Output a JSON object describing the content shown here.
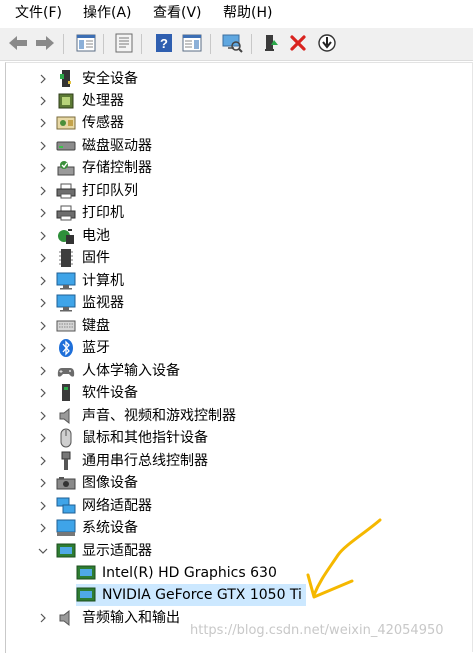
{
  "menu": {
    "file": "文件(F)",
    "action": "操作(A)",
    "view": "查看(V)",
    "help": "帮助(H)"
  },
  "toolbar": {
    "buttons": [
      "back-icon",
      "forward-icon",
      "show-hide-tree-icon",
      "properties-icon",
      "help-icon",
      "action-pane-icon",
      "scan-hardware-icon",
      "enable-device-icon",
      "uninstall-device-icon",
      "update-driver-icon"
    ]
  },
  "tree": {
    "categories": [
      {
        "label": "安全设备",
        "icon": "security-device-icon",
        "expanded": false
      },
      {
        "label": "处理器",
        "icon": "processor-icon",
        "expanded": false
      },
      {
        "label": "传感器",
        "icon": "sensor-icon",
        "expanded": false
      },
      {
        "label": "磁盘驱动器",
        "icon": "disk-drive-icon",
        "expanded": false
      },
      {
        "label": "存储控制器",
        "icon": "storage-controller-icon",
        "expanded": false
      },
      {
        "label": "打印队列",
        "icon": "print-queue-icon",
        "expanded": false
      },
      {
        "label": "打印机",
        "icon": "printer-icon",
        "expanded": false
      },
      {
        "label": "电池",
        "icon": "battery-icon",
        "expanded": false
      },
      {
        "label": "固件",
        "icon": "firmware-icon",
        "expanded": false
      },
      {
        "label": "计算机",
        "icon": "computer-icon",
        "expanded": false
      },
      {
        "label": "监视器",
        "icon": "monitor-icon",
        "expanded": false
      },
      {
        "label": "键盘",
        "icon": "keyboard-icon",
        "expanded": false
      },
      {
        "label": "蓝牙",
        "icon": "bluetooth-icon",
        "expanded": false
      },
      {
        "label": "人体学输入设备",
        "icon": "hid-icon",
        "expanded": false
      },
      {
        "label": "软件设备",
        "icon": "software-device-icon",
        "expanded": false
      },
      {
        "label": "声音、视频和游戏控制器",
        "icon": "audio-icon",
        "expanded": false
      },
      {
        "label": "鼠标和其他指针设备",
        "icon": "mouse-icon",
        "expanded": false
      },
      {
        "label": "通用串行总线控制器",
        "icon": "usb-icon",
        "expanded": false
      },
      {
        "label": "图像设备",
        "icon": "camera-icon",
        "expanded": false
      },
      {
        "label": "网络适配器",
        "icon": "network-adapter-icon",
        "expanded": false
      },
      {
        "label": "系统设备",
        "icon": "system-device-icon",
        "expanded": false
      },
      {
        "label": "显示适配器",
        "icon": "display-adapter-icon",
        "expanded": true
      }
    ],
    "display_children": [
      {
        "label": "Intel(R) HD Graphics 630",
        "icon": "display-adapter-icon",
        "selected": false
      },
      {
        "label": "NVIDIA GeForce GTX 1050 Ti",
        "icon": "display-adapter-icon",
        "selected": true
      }
    ],
    "after": {
      "label": "音频输入和输出",
      "icon": "audio-icon",
      "expanded": false
    }
  },
  "watermark": "https://blog.csdn.net/weixin_42054950",
  "colors": {
    "selection": "#cce8ff",
    "annotation": "#f5b800"
  }
}
